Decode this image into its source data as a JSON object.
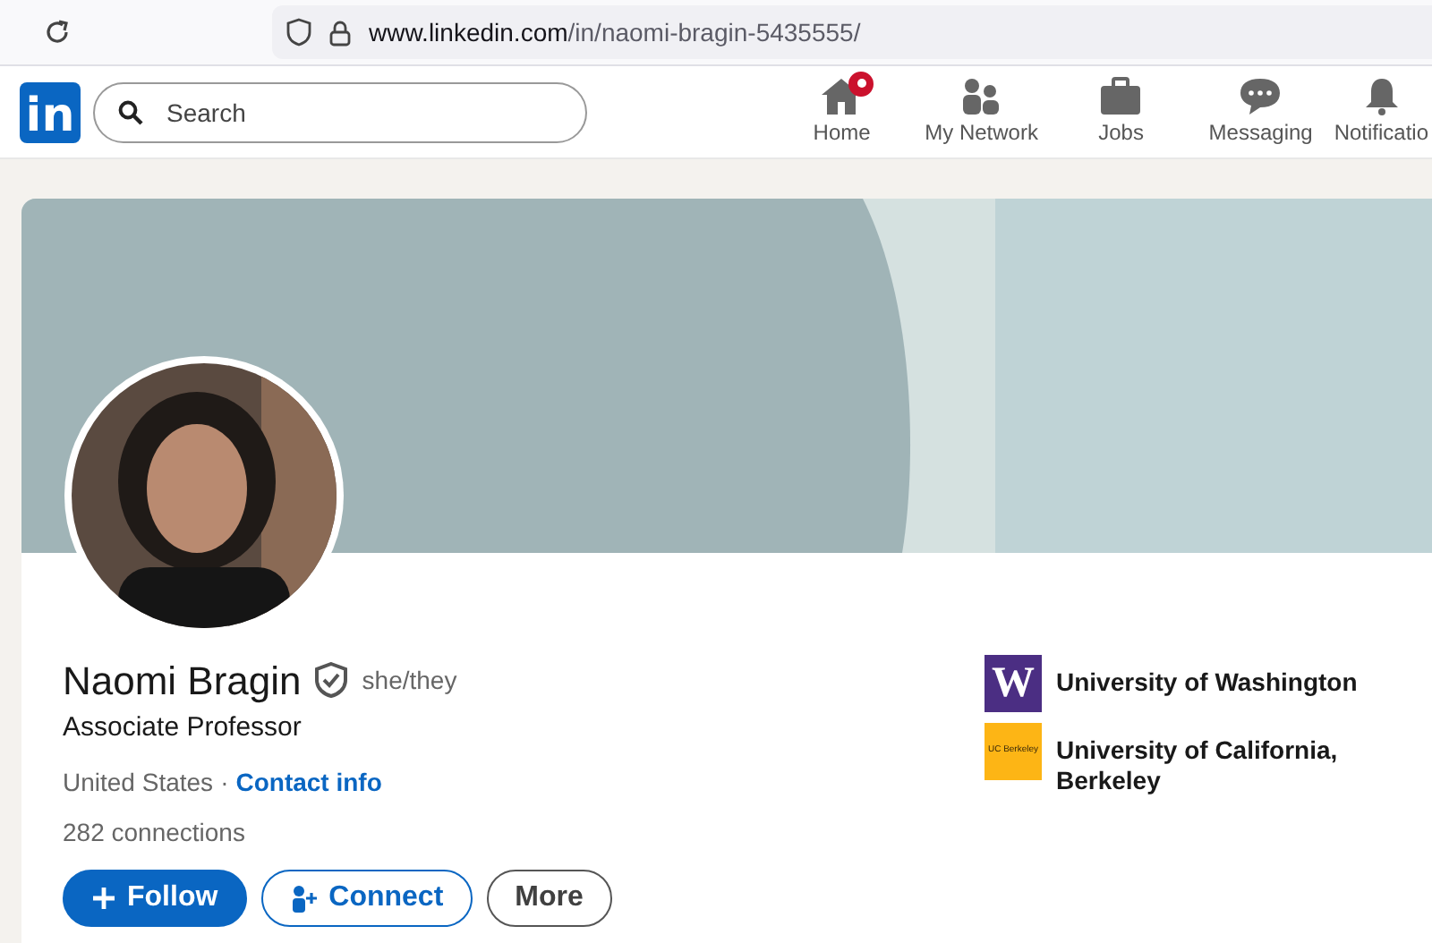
{
  "browser": {
    "url_host": "www.linkedin.com",
    "url_path": "/in/naomi-bragin-5435555/"
  },
  "nav": {
    "logo": "in",
    "search": {
      "placeholder": "Search"
    },
    "items": [
      {
        "label": "Home",
        "kind": "home",
        "badge": true
      },
      {
        "label": "My Network",
        "kind": "network",
        "badge": false
      },
      {
        "label": "Jobs",
        "kind": "jobs",
        "badge": false
      },
      {
        "label": "Messaging",
        "kind": "messaging",
        "badge": false
      },
      {
        "label": "Notificatio",
        "kind": "bell",
        "badge": false
      }
    ]
  },
  "profile": {
    "name": "Naomi Bragin",
    "verified": true,
    "pronouns": "she/they",
    "headline": "Associate Professor",
    "location": "United States",
    "separator": "·",
    "contact_link": "Contact info",
    "connections": "282 connections",
    "actions": [
      {
        "label": "Follow",
        "kind": "primary"
      },
      {
        "label": "Connect",
        "kind": "outline-blue"
      },
      {
        "label": "More",
        "kind": "outline-gray"
      }
    ],
    "education": [
      {
        "name": "University of Washington",
        "logo_text": "W",
        "color": "#4b2e83"
      },
      {
        "name": "University of California, Berkeley",
        "logo_text": "UC Berkeley",
        "color": "#fdb515"
      }
    ]
  }
}
